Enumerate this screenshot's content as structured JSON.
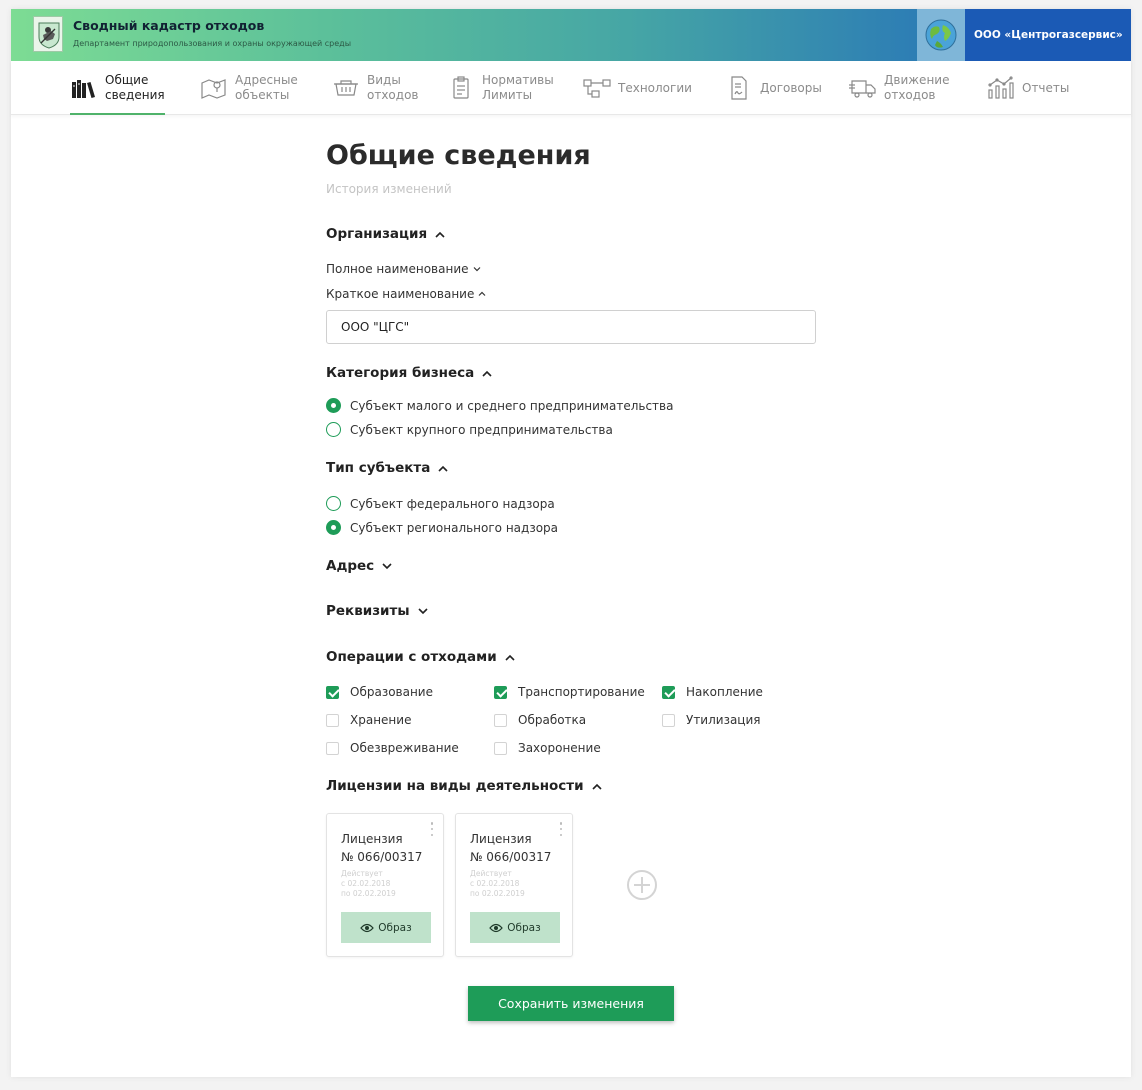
{
  "header": {
    "app_title": "Сводный кадастр отходов",
    "app_subtitle": "Департамент природопользования и охраны окружающей среды",
    "org_name": "ООО «Центрогазсервис»"
  },
  "nav": {
    "items": [
      {
        "line1": "Общие",
        "line2": "сведения",
        "icon": "books-icon",
        "active": true
      },
      {
        "line1": "Адресные",
        "line2": "объекты",
        "icon": "map-pin-icon"
      },
      {
        "line1": "Виды",
        "line2": "отходов",
        "icon": "container-icon"
      },
      {
        "line1": "Нормативы",
        "line2": "Лимиты",
        "icon": "clipboard-icon"
      },
      {
        "line1": "Технологии",
        "line2": "",
        "icon": "flow-icon"
      },
      {
        "line1": "Договоры",
        "line2": "",
        "icon": "document-icon"
      },
      {
        "line1": "Движение",
        "line2": "отходов",
        "icon": "truck-icon"
      },
      {
        "line1": "Отчеты",
        "line2": "",
        "icon": "chart-icon"
      }
    ]
  },
  "page": {
    "title": "Общие сведения",
    "history_link": "История изменений"
  },
  "organization": {
    "title": "Организация",
    "full_name_label": "Полное наименование",
    "short_name_label": "Краткое наименование",
    "short_name_value": "ООО \"ЦГС\""
  },
  "business_category": {
    "title": "Категория бизнеса",
    "options": [
      {
        "label": "Субъект малого и среднего предпринимательства",
        "selected": true
      },
      {
        "label": "Субъект крупного предпринимательства",
        "selected": false
      }
    ]
  },
  "subject_type": {
    "title": "Тип субъекта",
    "options": [
      {
        "label": "Субъект федерального надзора",
        "selected": false
      },
      {
        "label": "Субъект регионального надзора",
        "selected": true
      }
    ]
  },
  "address": {
    "title": "Адрес"
  },
  "requisites": {
    "title": "Реквизиты"
  },
  "waste_operations": {
    "title": "Операции с отходами",
    "items": [
      {
        "label": "Образование",
        "checked": true
      },
      {
        "label": "Транспортирование",
        "checked": true
      },
      {
        "label": "Накопление",
        "checked": true
      },
      {
        "label": "Хранение",
        "checked": false
      },
      {
        "label": "Обработка",
        "checked": false
      },
      {
        "label": "Утилизация",
        "checked": false
      },
      {
        "label": "Обезвреживание",
        "checked": false
      },
      {
        "label": "Захоронение",
        "checked": false
      }
    ]
  },
  "licenses": {
    "title": "Лицензии на виды деятельности",
    "cards": [
      {
        "title": "Лицензия",
        "number": "№ 066/00317",
        "status": "Действует",
        "from": "с 02.02.2018",
        "to": "по 02.02.2019",
        "button": "Образ"
      },
      {
        "title": "Лицензия",
        "number": "№ 066/00317",
        "status": "Действует",
        "from": "с 02.02.2018",
        "to": "по 02.02.2019",
        "button": "Образ"
      }
    ]
  },
  "actions": {
    "save_label": "Сохранить изменения"
  },
  "colors": {
    "accent": "#1e9c58",
    "header_start": "#7ddc94",
    "header_end": "#1b5bb5",
    "image_button": "#bfe2cb"
  }
}
